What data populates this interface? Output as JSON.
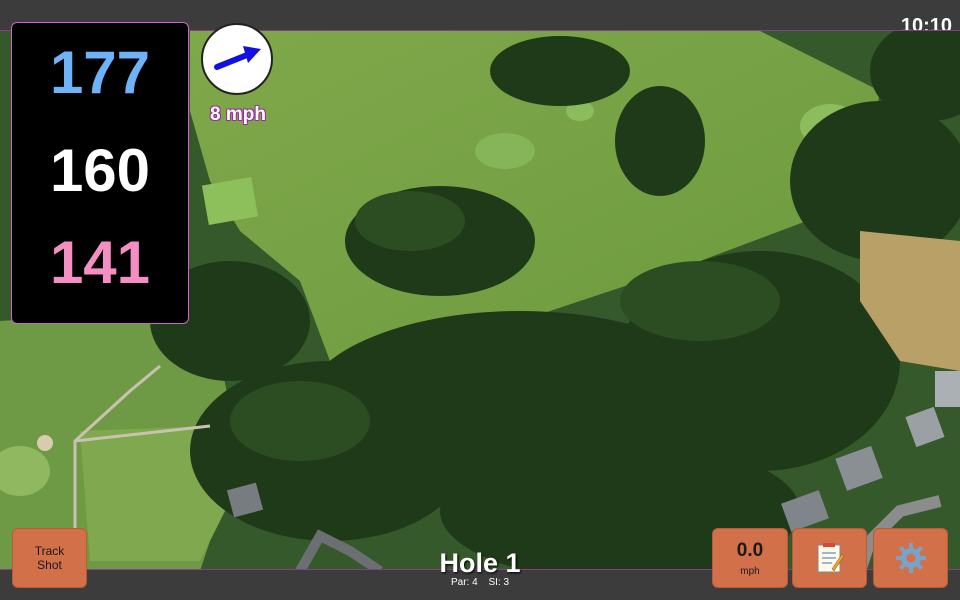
{
  "status_bar": {
    "time": "10:10"
  },
  "distances": {
    "back": "177",
    "center": "160",
    "front": "141"
  },
  "wind": {
    "speed_label": "8 mph",
    "direction_icon": "arrow-east-northeast-icon"
  },
  "hole": {
    "title": "Hole 1",
    "par": "Par: 4",
    "stroke_index": "SI: 3"
  },
  "buttons": {
    "track_shot_line1": "Track",
    "track_shot_line2": "Shot",
    "speed_value": "0.0",
    "speed_unit": "mph",
    "notes_icon": "notepad-icon",
    "settings_icon": "gear-icon"
  },
  "colors": {
    "back_distance": "#6eb3f7",
    "center_distance": "#ffffff",
    "front_distance": "#f48fc4",
    "button_bg": "#d2704a",
    "panel_border": "#cc66cc"
  }
}
